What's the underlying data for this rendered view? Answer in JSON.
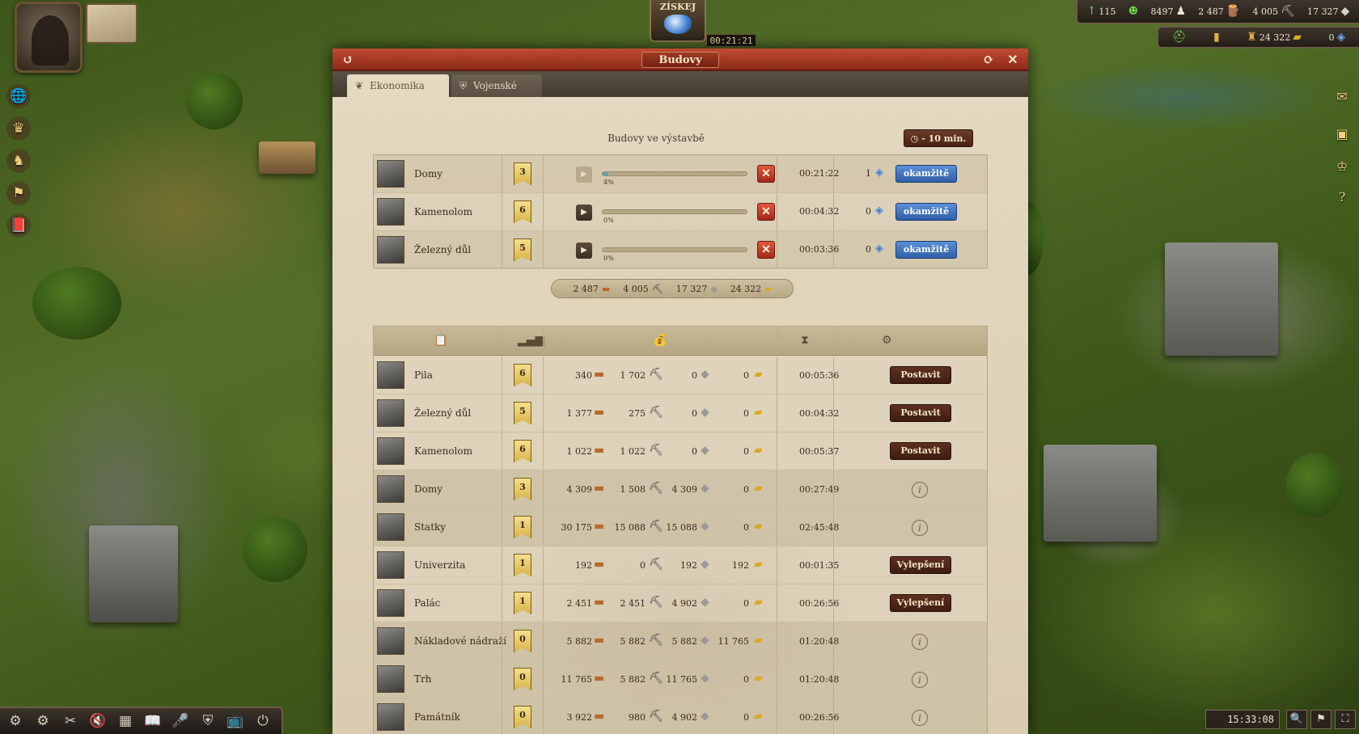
{
  "claim": {
    "label": "ZÍSKEJ",
    "timer": "00:21:21"
  },
  "resources_top": [
    {
      "icon": "arrow-up-icon",
      "value": "115"
    },
    {
      "icon": "smiley-icon",
      "value": ""
    },
    {
      "icon": "population-icon",
      "value": "8497"
    },
    {
      "icon": "wood-icon",
      "value": "2 487"
    },
    {
      "icon": "iron-icon",
      "value": "4 005"
    },
    {
      "icon": "stone-icon",
      "value": "17 327"
    }
  ],
  "resources_second": [
    {
      "icon": "helmet-icon",
      "value": ""
    },
    {
      "icon": "chart-icon",
      "value": ""
    },
    {
      "icon": "gold-icon",
      "value": "24 322"
    },
    {
      "icon": "gem-icon",
      "value": "0"
    }
  ],
  "clock": "15:33:08",
  "window": {
    "title": "Budovy",
    "tabs": [
      {
        "label": "Ekonomika",
        "active": true
      },
      {
        "label": "Vojenské",
        "active": false
      }
    ]
  },
  "construction": {
    "heading": "Budovy ve výstavbě",
    "speedup_label": "- 10 min.",
    "queue": [
      {
        "name": "Domy",
        "level": "3",
        "progress_pct": 4,
        "pct_label": "4%",
        "time": "00:21:22",
        "gem_cost": "1",
        "instant_label": "okamžitě",
        "active": true
      },
      {
        "name": "Kamenolom",
        "level": "6",
        "progress_pct": 0,
        "pct_label": "0%",
        "time": "00:04:32",
        "gem_cost": "0",
        "instant_label": "okamžitě",
        "active": false
      },
      {
        "name": "Železný důl",
        "level": "5",
        "progress_pct": 0,
        "pct_label": "0%",
        "time": "00:03:36",
        "gem_cost": "0",
        "instant_label": "okamžitě",
        "active": false
      }
    ]
  },
  "resource_pill": {
    "wood": "2 487",
    "iron": "4 005",
    "stone": "17 327",
    "gold": "24 322"
  },
  "buildings": [
    {
      "name": "Pila",
      "level": "6",
      "wood": "340",
      "iron": "1 702",
      "stone": "0",
      "gold": "0",
      "time": "00:05:36",
      "action": "Postavit",
      "kind": "build"
    },
    {
      "name": "Železný důl",
      "level": "5",
      "wood": "1 377",
      "iron": "275",
      "stone": "0",
      "gold": "0",
      "time": "00:04:32",
      "action": "Postavit",
      "kind": "build"
    },
    {
      "name": "Kamenolom",
      "level": "6",
      "wood": "1 022",
      "iron": "1 022",
      "stone": "0",
      "gold": "0",
      "time": "00:05:37",
      "action": "Postavit",
      "kind": "build"
    },
    {
      "name": "Domy",
      "level": "3",
      "wood": "4 309",
      "iron": "1 508",
      "stone": "4 309",
      "gold": "0",
      "time": "00:27:49",
      "action": "",
      "kind": "info"
    },
    {
      "name": "Statky",
      "level": "1",
      "wood": "30 175",
      "iron": "15 088",
      "stone": "15 088",
      "gold": "0",
      "time": "02:45:48",
      "action": "",
      "kind": "info"
    },
    {
      "name": "Univerzita",
      "level": "1",
      "wood": "192",
      "iron": "0",
      "stone": "192",
      "gold": "192",
      "time": "00:01:35",
      "action": "Vylepšení",
      "kind": "build"
    },
    {
      "name": "Palác",
      "level": "1",
      "wood": "2 451",
      "iron": "2 451",
      "stone": "4 902",
      "gold": "0",
      "time": "00:26:56",
      "action": "Vylepšení",
      "kind": "build"
    },
    {
      "name": "Nákladové nádraží",
      "level": "0",
      "wood": "5 882",
      "iron": "5 882",
      "stone": "5 882",
      "gold": "11 765",
      "time": "01:20:48",
      "action": "",
      "kind": "info"
    },
    {
      "name": "Trh",
      "level": "0",
      "wood": "11 765",
      "iron": "5 882",
      "stone": "11 765",
      "gold": "0",
      "time": "01:20:48",
      "action": "",
      "kind": "info"
    },
    {
      "name": "Památník",
      "level": "0",
      "wood": "3 922",
      "iron": "980",
      "stone": "4 902",
      "gold": "0",
      "time": "00:26:56",
      "action": "",
      "kind": "info"
    }
  ],
  "icons": {
    "wood": "🪵",
    "iron": "⛏",
    "stone": "◆",
    "gold": "▰",
    "gem": "💎"
  }
}
